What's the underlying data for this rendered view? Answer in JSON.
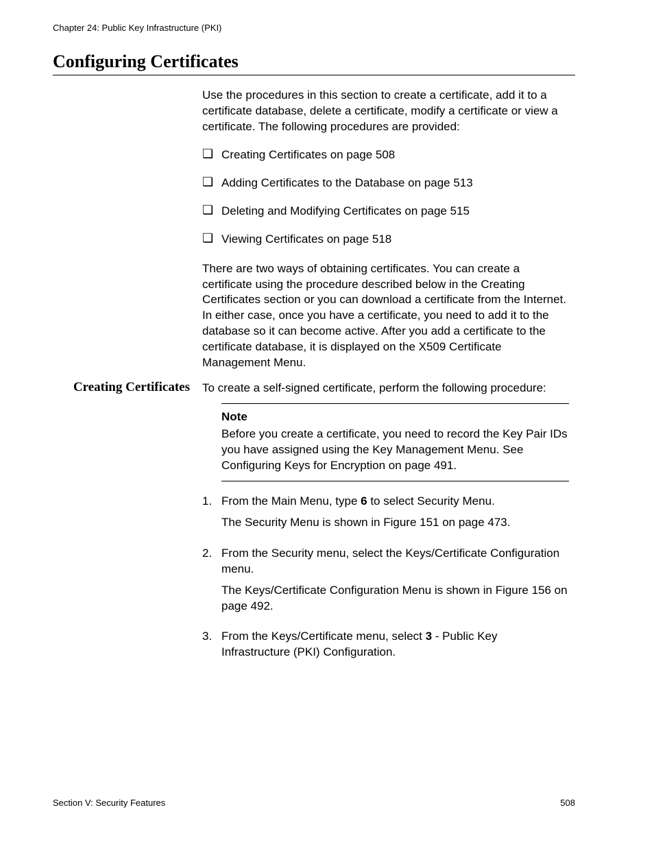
{
  "running_head": "Chapter 24: Public Key Infrastructure (PKI)",
  "footer_left": "Section V: Security Features",
  "footer_right": "508",
  "heading": "Configuring Certificates",
  "intro": "Use the procedures in this section to create a certificate, add it to a certificate database, delete a certificate, modify a certificate or view a certificate. The following procedures are provided:",
  "bullets": [
    "Creating Certificates on page 508",
    "Adding Certificates to the Database on page 513",
    "Deleting and Modifying Certificates on page 515",
    "Viewing Certificates on page 518"
  ],
  "para2": "There are two ways of obtaining certificates. You can create a certificate using the procedure described below in the Creating Certificates section or you can download a certificate from the Internet. In either case, once you have a certificate, you need to add it to the database so it can become active. After you add a certificate to the certificate database, it is displayed on the X509 Certificate Management Menu.",
  "sidehead": "Creating Certificates",
  "lead_in": "To create a self-signed certificate, perform the following procedure:",
  "note_label": "Note",
  "note_body": "Before you create a certificate, you need to record the Key Pair IDs you have assigned using the Key Management Menu. See Configuring Keys for Encryption on page 491.",
  "step1_a": "From the Main Menu, type ",
  "step1_bold": "6",
  "step1_b": " to select Security Menu.",
  "step1_follow": "The Security Menu is shown in Figure 151 on page 473.",
  "step2_a": "From the Security menu, select the Keys/Certificate Configuration menu.",
  "step2_follow": "The Keys/Certificate Configuration Menu is shown in Figure 156 on page 492.",
  "step3_a": "From the Keys/Certificate menu, select ",
  "step3_bold": "3",
  "step3_b": " - Public Key Infrastructure (PKI) Configuration."
}
